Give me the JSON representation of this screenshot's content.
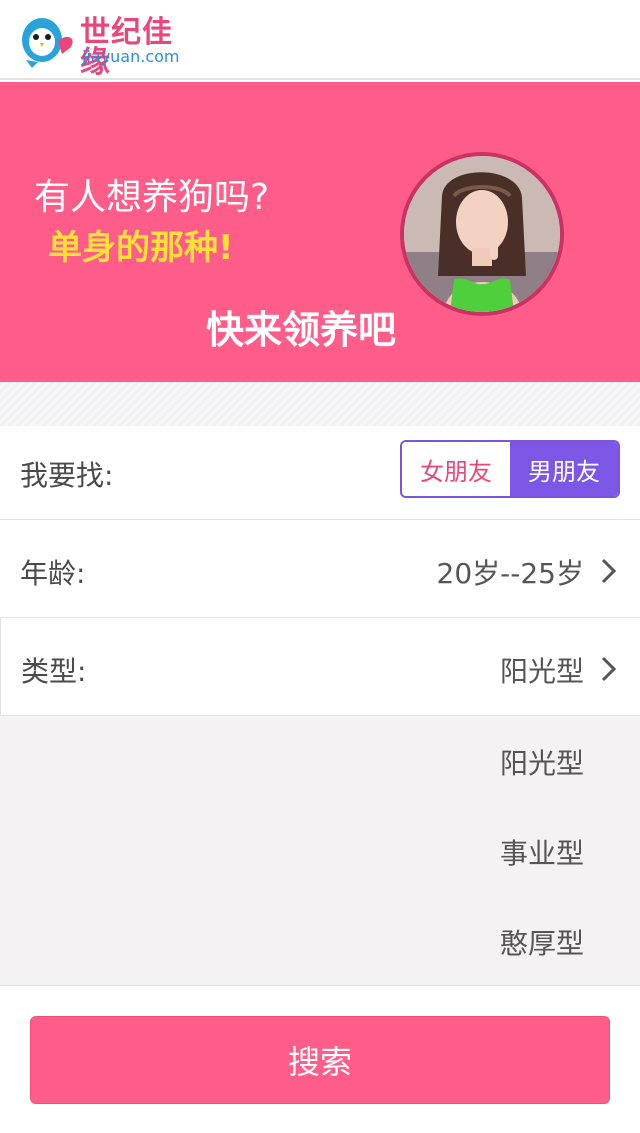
{
  "header": {
    "brand_name": "世纪佳缘",
    "brand_domain": "jiayuan.com"
  },
  "banner": {
    "line1": "有人想养狗吗?",
    "line2": "单身的那种!",
    "line3": "快来领养吧"
  },
  "filters": {
    "seek": {
      "label": "我要找:",
      "options": [
        "女朋友",
        "男朋友"
      ],
      "selected": "男朋友"
    },
    "age": {
      "label": "年龄:",
      "value": "20岁--25岁"
    },
    "type": {
      "label": "类型:",
      "value": "阳光型"
    }
  },
  "dropdown": {
    "options": [
      "阳光型",
      "事业型",
      "憨厚型"
    ]
  },
  "actions": {
    "search_label": "搜索"
  },
  "colors": {
    "brand_pink": "#ff5d89",
    "accent_purple": "#7c57e6",
    "highlight_yellow": "#ffe13a"
  }
}
